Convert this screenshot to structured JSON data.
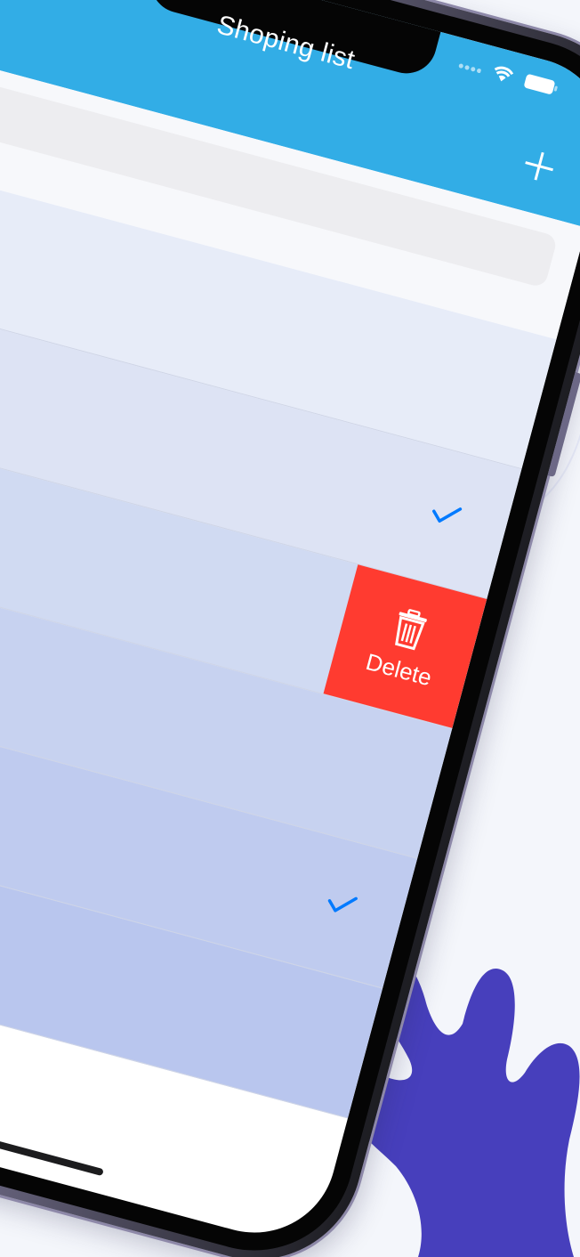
{
  "app": {
    "title": "Shoping list",
    "add_icon": "plus-icon",
    "status_icons": [
      "signal-icon",
      "wifi-icon",
      "battery-icon"
    ]
  },
  "search": {
    "placeholder": ""
  },
  "list": {
    "rows": [
      {
        "label": "",
        "checked": false,
        "color": "#e7ecf8"
      },
      {
        "label": "",
        "checked": true,
        "color": "#dde3f4"
      },
      {
        "label": "",
        "checked": false,
        "color": "#d0daf2",
        "delete_revealed": true
      },
      {
        "label": "",
        "checked": false,
        "color": "#c7d2f0"
      },
      {
        "label": "",
        "checked": true,
        "color": "#bfcbef"
      },
      {
        "label": "",
        "checked": false,
        "color": "#b9c6ee"
      }
    ],
    "delete_label": "Delete",
    "delete_icon": "trash-icon"
  },
  "colors": {
    "navbar": "#32ade6",
    "accent": "#007aff",
    "delete": "#ff3b30",
    "blob": "#473fbc",
    "background": "#f4f6fb"
  }
}
